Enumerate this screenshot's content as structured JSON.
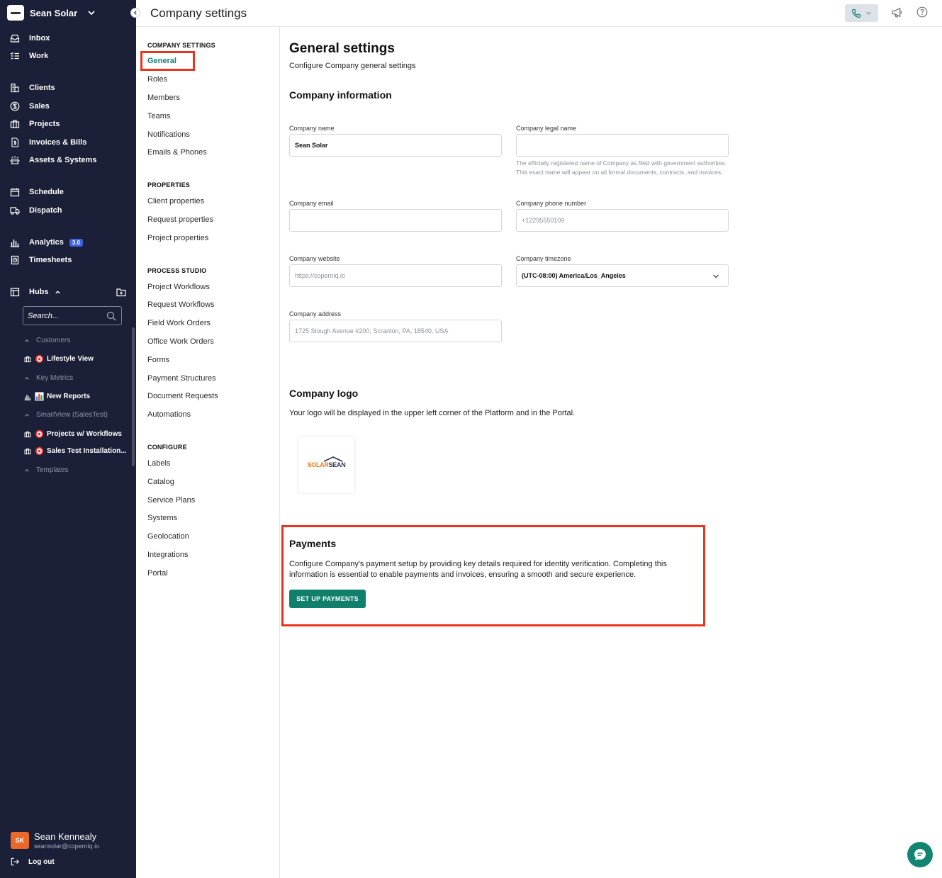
{
  "workspace": {
    "name": "Sean Solar"
  },
  "nav": {
    "inbox": "Inbox",
    "work": "Work",
    "clients": "Clients",
    "sales": "Sales",
    "projects": "Projects",
    "invoices": "Invoices & Bills",
    "assets": "Assets & Systems",
    "schedule": "Schedule",
    "dispatch": "Dispatch",
    "analytics": "Analytics",
    "analytics_badge": "3.0",
    "timesheets": "Timesheets",
    "hubs": "Hubs"
  },
  "hubs": {
    "search_placeholder": "Search...",
    "groups": [
      "Customers",
      "Key Metrics",
      "SmartView (SalesTest)",
      "Templates"
    ],
    "items": [
      "Lifestyle View",
      "New Reports",
      "Projects w/ Workflows",
      "Sales Test Installation..."
    ]
  },
  "user": {
    "initials": "SK",
    "name": "Sean Kennealy",
    "email": "seansolar@coperniq.io",
    "logout": "Log out"
  },
  "topbar": {
    "title": "Company settings"
  },
  "settings_menu": {
    "company_settings": {
      "heading": "COMPANY SETTINGS",
      "items": [
        "General",
        "Roles",
        "Members",
        "Teams",
        "Notifications",
        "Emails & Phones"
      ]
    },
    "properties": {
      "heading": "PROPERTIES",
      "items": [
        "Client properties",
        "Request properties",
        "Project properties"
      ]
    },
    "process_studio": {
      "heading": "PROCESS STUDIO",
      "items": [
        "Project Workflows",
        "Request Workflows",
        "Field Work Orders",
        "Office Work Orders",
        "Forms",
        "Payment Structures",
        "Document Requests",
        "Automations"
      ]
    },
    "configure": {
      "heading": "CONFIGURE",
      "items": [
        "Labels",
        "Catalog",
        "Service Plans",
        "Systems",
        "Geolocation",
        "Integrations",
        "Portal"
      ]
    }
  },
  "general": {
    "title": "General settings",
    "subtitle": "Configure Company general settings",
    "info_heading": "Company information",
    "fields": {
      "company_name": {
        "label": "Company name",
        "value": "Sean Solar"
      },
      "legal_name": {
        "label": "Company legal name",
        "value": "",
        "help": "The officially registered name of Company as filed with government authorities. This exact name will appear on all formal documents, contracts, and invoices."
      },
      "email": {
        "label": "Company email",
        "value": ""
      },
      "phone": {
        "label": "Company phone number",
        "placeholder": "+12295550109"
      },
      "website": {
        "label": "Company website",
        "placeholder": "https://coperniq.io"
      },
      "timezone": {
        "label": "Company timezone",
        "value": "(UTC-08:00) America/Los_Angeles"
      },
      "address": {
        "label": "Company address",
        "placeholder": "1725 Slough Avenue #200, Scranton, PA, 18540, USA"
      }
    },
    "logo": {
      "heading": "Company logo",
      "description": "Your logo will be displayed in the upper left corner of the Platform and in the Portal.",
      "word_a": "SOLAR",
      "word_b": "SEAN"
    },
    "payments": {
      "heading": "Payments",
      "description": "Configure Company's payment setup by providing key details required for identity verification. Completing this information is essential to enable payments and invoices, ensuring a smooth and secure experience.",
      "button": "SET UP PAYMENTS"
    }
  },
  "colors": {
    "sidebar_bg": "#1b1f37",
    "accent_teal": "#10806c",
    "highlight_red": "#e8351f",
    "badge_blue": "#4063e6"
  }
}
